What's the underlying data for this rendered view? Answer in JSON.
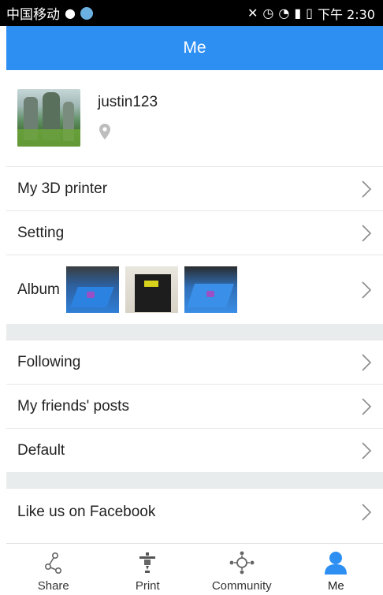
{
  "status_bar": {
    "carrier": "中国移动",
    "time": "下午 2:30"
  },
  "header": {
    "title": "Me"
  },
  "profile": {
    "username": "justin123"
  },
  "menu_group_1": [
    {
      "label": "My 3D printer"
    },
    {
      "label": "Setting"
    },
    {
      "label": "Album"
    }
  ],
  "menu_group_2": [
    {
      "label": "Following"
    },
    {
      "label": "My friends' posts"
    },
    {
      "label": "Default"
    }
  ],
  "menu_group_3": [
    {
      "label": "Like us on Facebook"
    }
  ],
  "tabs": [
    {
      "label": "Share",
      "icon": "share-icon"
    },
    {
      "label": "Print",
      "icon": "printer-icon"
    },
    {
      "label": "Community",
      "icon": "community-icon"
    },
    {
      "label": "Me",
      "icon": "person-icon",
      "active": true
    }
  ],
  "colors": {
    "accent": "#2e8ff3",
    "section_gap": "#e9ecec"
  }
}
